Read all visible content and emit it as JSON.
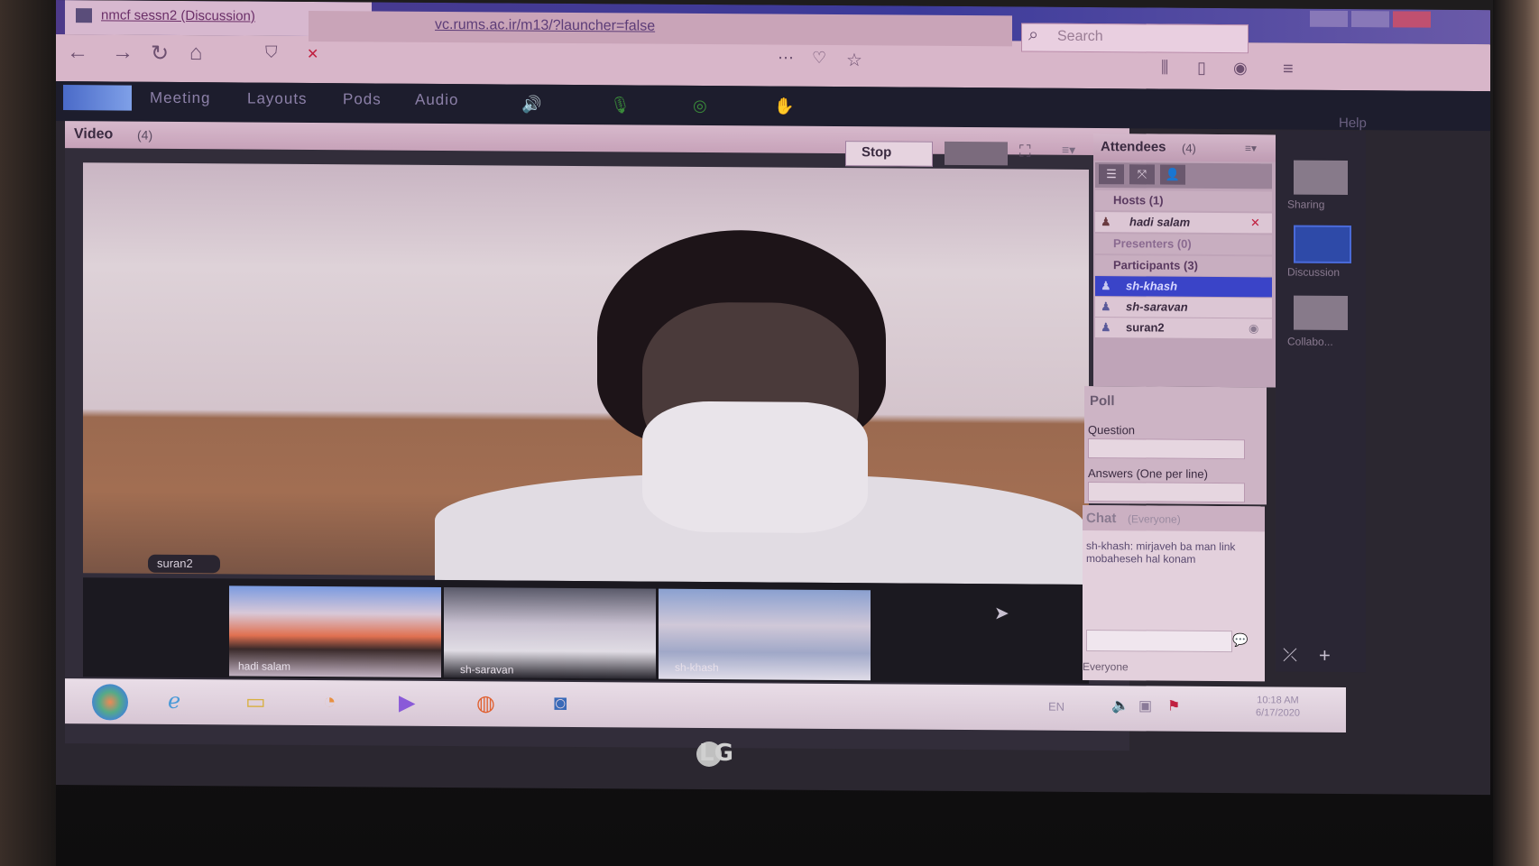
{
  "browser": {
    "tab_title": "nmcf sessn2 (Discussion)",
    "url": "vc.rums.ac.ir/m13/?launcher=false",
    "search_placeholder": "Search"
  },
  "app": {
    "menu": [
      "Meeting",
      "Layouts",
      "Pods",
      "Audio"
    ],
    "help": "Help"
  },
  "video_pod": {
    "title": "Video",
    "count": "(4)",
    "stop_label": "Stop",
    "main_speaker": "suran2",
    "thumbnails": [
      {
        "name": "hadi salam"
      },
      {
        "name": "sh-saravan"
      },
      {
        "name": "sh-khash"
      }
    ]
  },
  "attendees_pod": {
    "title": "Attendees",
    "count": "(4)",
    "sections": {
      "hosts": "Hosts (1)",
      "presenters": "Presenters (0)",
      "participants": "Participants (3)"
    },
    "hosts": [
      "hadi salam"
    ],
    "participants": [
      "sh-khash",
      "sh-saravan",
      "suran2"
    ]
  },
  "poll_pod": {
    "title": "Poll",
    "question_label": "Question",
    "answers_label": "Answers (One per line)"
  },
  "chat_pod": {
    "title": "Chat",
    "scope": "(Everyone)",
    "message": "sh-khash: mirjaveh ba man link mobaheseh hal konam",
    "recipient": "Everyone"
  },
  "layouts": [
    "Sharing",
    "Discussion",
    "Collabo..."
  ],
  "taskbar": {
    "clock_time": "10:18 AM",
    "clock_date": "6/17/2020"
  },
  "monitor_brand": "LG",
  "colors": {
    "selected_row": "#3a44c8",
    "menubar": "#1d1d2d",
    "pod_header": "#d7b9cc"
  }
}
